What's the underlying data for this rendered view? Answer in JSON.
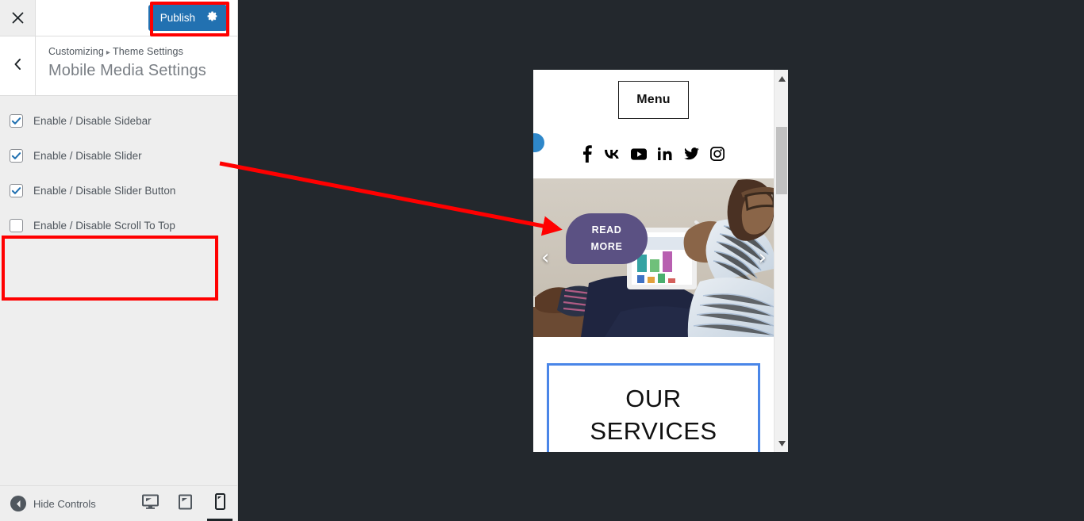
{
  "customizer": {
    "close_icon": "close-icon",
    "publish": {
      "label": "Publish",
      "icon": "gear-icon",
      "color": "#2271b1"
    },
    "back_icon": "chevron-left-icon",
    "breadcrumb": {
      "root": "Customizing",
      "separator": "▸",
      "parent": "Theme Settings"
    },
    "panel_title": "Mobile Media Settings",
    "controls": [
      {
        "label": "Enable / Disable Sidebar",
        "checked": true
      },
      {
        "label": "Enable / Disable Slider",
        "checked": true
      },
      {
        "label": "Enable / Disable Slider Button",
        "checked": true
      },
      {
        "label": "Enable / Disable Scroll To Top",
        "checked": false
      }
    ],
    "footer": {
      "hide_controls_label": "Hide Controls",
      "collapse_icon": "collapse-left-icon",
      "devices": [
        {
          "name": "desktop",
          "icon": "desktop-icon",
          "active": false
        },
        {
          "name": "tablet",
          "icon": "tablet-icon",
          "active": false
        },
        {
          "name": "mobile",
          "icon": "mobile-icon",
          "active": true
        }
      ]
    }
  },
  "annotations": {
    "highlight_color": "#ff0000",
    "publish_box": "publish-button-highlight",
    "slider_controls_box": "slider-controls-highlight",
    "arrow": "slider-controls-to-preview-arrow"
  },
  "preview": {
    "device": "mobile",
    "site": {
      "menu_label": "Menu",
      "social_icons": [
        {
          "name": "facebook-icon",
          "glyph": "f"
        },
        {
          "name": "vk-icon",
          "glyph": "VK"
        },
        {
          "name": "youtube-icon",
          "glyph": "▶"
        },
        {
          "name": "linkedin-icon",
          "glyph": "in"
        },
        {
          "name": "twitter-icon",
          "glyph": "bird"
        },
        {
          "name": "instagram-icon",
          "glyph": "camera"
        }
      ],
      "slider": {
        "prev_arrow": "‹",
        "next_arrow": "›",
        "button_line1": "READ",
        "button_line2": "MORE",
        "button_color": "#5b5183",
        "image_alt": "man-with-tablet-photo"
      },
      "services": {
        "title_line1": "OUR",
        "title_line2": "SERVICES",
        "border_color": "#4a86e8"
      }
    },
    "scrollbar": {
      "up_arrow": "▲",
      "down_arrow": "▼"
    }
  }
}
